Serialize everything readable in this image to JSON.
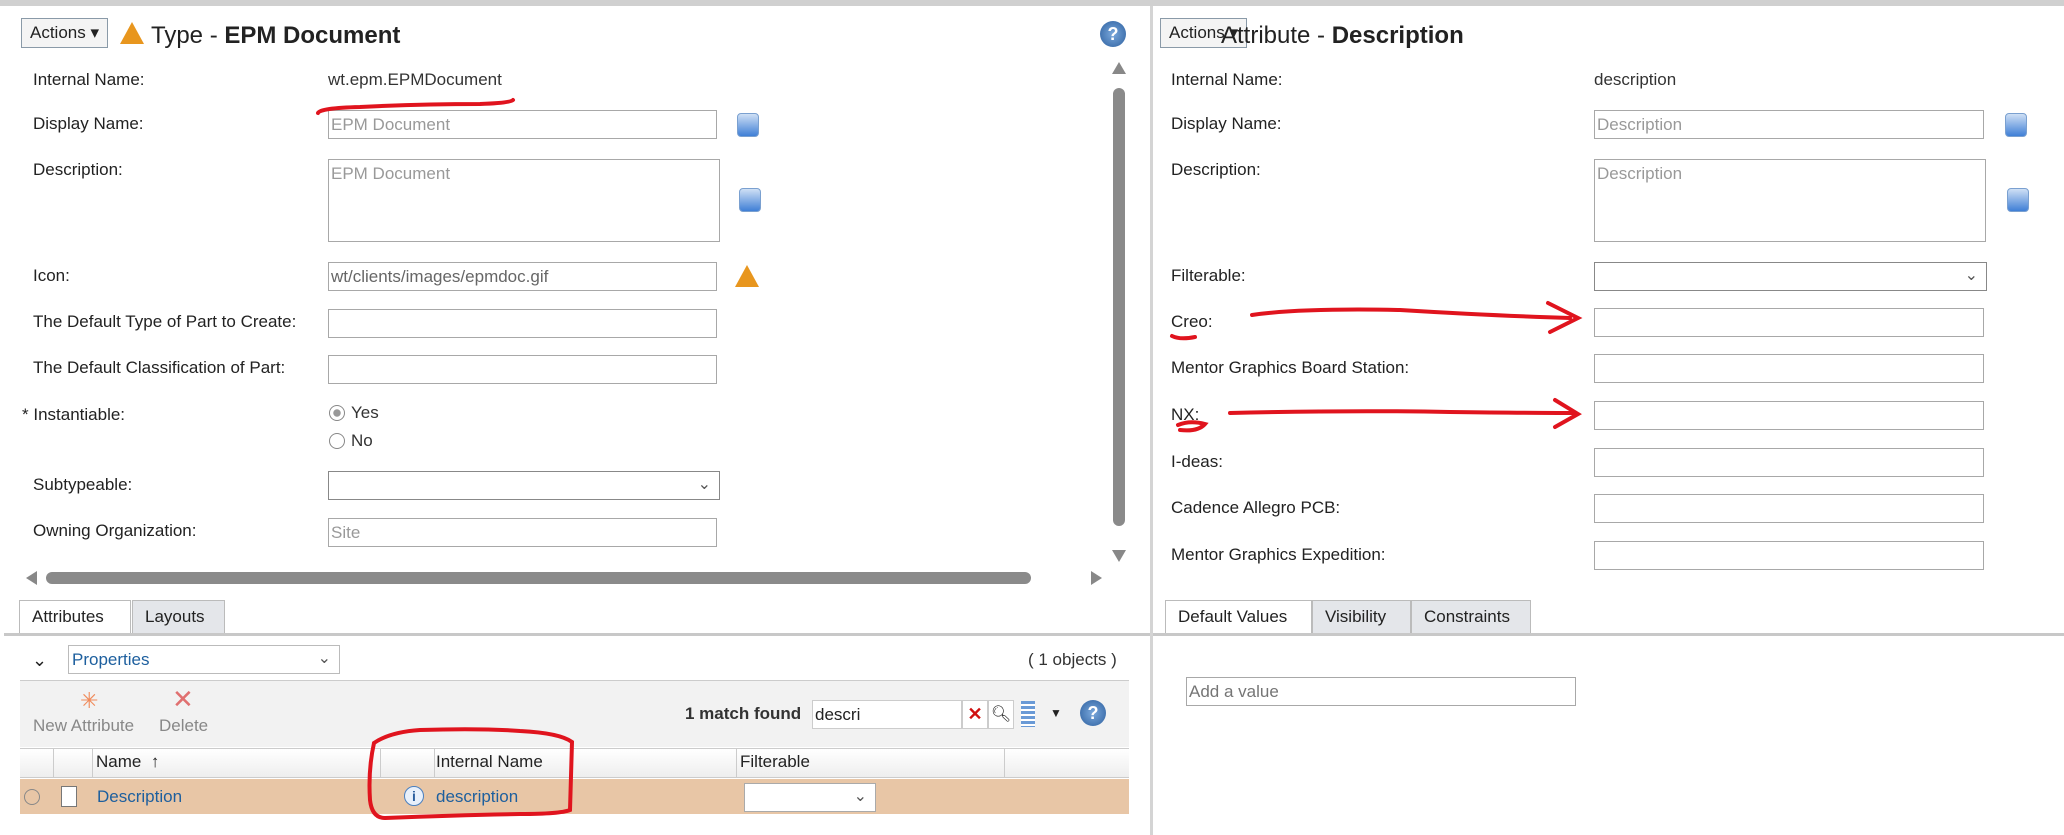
{
  "left": {
    "actions_label": "Actions",
    "title_prefix": "Type - ",
    "title_name": "EPM Document",
    "fields": {
      "internal_name": {
        "label": "Internal Name:",
        "value": "wt.epm.EPMDocument"
      },
      "display_name": {
        "label": "Display Name:",
        "value": "EPM Document"
      },
      "description": {
        "label": "Description:",
        "value": "EPM Document"
      },
      "icon": {
        "label": "Icon:",
        "value": "wt/clients/images/epmdoc.gif"
      },
      "default_type": {
        "label": "The Default Type of Part to Create:",
        "value": ""
      },
      "default_class": {
        "label": "The Default Classification of Part:",
        "value": ""
      },
      "instantiable": {
        "required_mark": "*",
        "label": "Instantiable:",
        "options": [
          "Yes",
          "No"
        ],
        "selected": "Yes"
      },
      "subtypeable": {
        "label": "Subtypeable:",
        "value": ""
      },
      "owning_org": {
        "label": "Owning Organization:",
        "value": "Site"
      }
    },
    "tabs": [
      "Attributes",
      "Layouts"
    ],
    "view_select": "Properties",
    "object_count": "( 1 objects )",
    "toolbar": {
      "new_attribute": "New Attribute",
      "delete": "Delete",
      "match_text": "1 match found",
      "search_value": "descri"
    },
    "table": {
      "columns": [
        "Name",
        "Internal Name",
        "Filterable"
      ],
      "sort_indicator": "↑",
      "rows": [
        {
          "name": "Description",
          "internal_name": "description",
          "filterable": ""
        }
      ]
    }
  },
  "right": {
    "actions_label": "Actions",
    "title_prefix": "Attribute - ",
    "title_name": "Description",
    "fields": {
      "internal_name": {
        "label": "Internal Name:",
        "value": "description"
      },
      "display_name": {
        "label": "Display Name:",
        "value": "Description"
      },
      "description": {
        "label": "Description:",
        "value": "Description"
      },
      "filterable": {
        "label": "Filterable:",
        "value": ""
      },
      "creo": {
        "label": "Creo:",
        "value": ""
      },
      "mentor_board": {
        "label": "Mentor Graphics Board Station:",
        "value": ""
      },
      "nx": {
        "label": "NX:",
        "value": ""
      },
      "ideas": {
        "label": "I-deas:",
        "value": ""
      },
      "cadence": {
        "label": "Cadence Allegro PCB:",
        "value": ""
      },
      "mentor_exp": {
        "label": "Mentor Graphics Expedition:",
        "value": ""
      }
    },
    "tabs": [
      "Default Values",
      "Visibility",
      "Constraints"
    ],
    "add_value_placeholder": "Add a value"
  },
  "colors": {
    "selected_row": "#e8c6a6",
    "annotation": "#e0141e",
    "link": "#1d5f9e"
  }
}
